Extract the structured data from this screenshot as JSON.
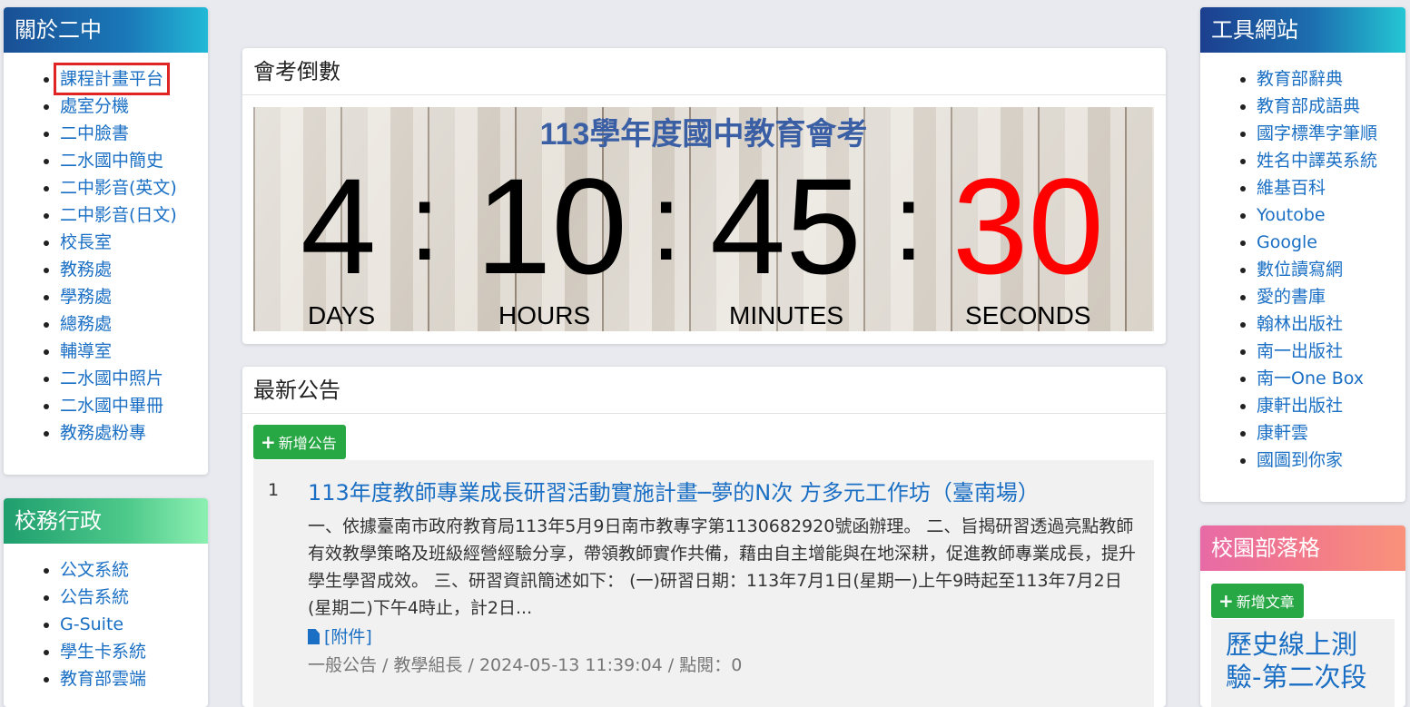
{
  "about": {
    "header": "關於二中",
    "items": [
      "課程計畫平台",
      "處室分機",
      "二中臉書",
      "二水國中簡史",
      "二中影音(英文)",
      "二中影音(日文)",
      "校長室",
      "教務處",
      "學務處",
      "總務處",
      "輔導室",
      "二水國中照片",
      "二水國中畢冊",
      "教務處粉專"
    ]
  },
  "admin": {
    "header": "校務行政",
    "items": [
      "公文系統",
      "公告系統",
      "G-Suite",
      "學生卡系統",
      "教育部雲端"
    ]
  },
  "countdown": {
    "header": "會考倒數",
    "title": "113學年度國中教育會考",
    "days": "4",
    "hours": "10",
    "minutes": "45",
    "seconds": "30",
    "colon": ":",
    "labels": {
      "days": "DAYS",
      "hours": "HOURS",
      "minutes": "MINUTES",
      "seconds": "SECONDS"
    },
    "colors": {
      "digits": "#000000",
      "seconds": "#ff0000",
      "title": "#3a5fa5"
    }
  },
  "news": {
    "header": "最新公告",
    "add_button": "新增公告",
    "plus_icon": "plus-icon",
    "items": [
      {
        "num": "1",
        "title": "113年度教師專業成長研習活動實施計畫─夢的N次 方多元工作坊（臺南場）",
        "body": "一、依據臺南市政府教育局113年5月9日南市教專字第1130682920號函辦理。 二、旨揭研習透過亮點教師有效教學策略及班級經營經驗分享，帶領教師實作共備，藉由自主增能與在地深耕，促進教師專業成長，提升學生學習成效。 三、研習資訊簡述如下： (一)研習日期：113年7月1日(星期一)上午9時起至113年7月2日(星期二)下午4時止，計2日...",
        "attach": "[附件]",
        "meta": "一般公告 / 教學組長 / 2024-05-13 11:39:04 / 點閱：0"
      }
    ]
  },
  "tools": {
    "header": "工具網站",
    "items": [
      "教育部辭典",
      "教育部成語典",
      "國字標準字筆順",
      "姓名中譯英系統",
      "維基百科",
      "Youtobe",
      "Google",
      "數位讀寫網",
      "愛的書庫",
      "翰林出版社",
      "南一出版社",
      "南一One Box",
      "康軒出版社",
      "康軒雲",
      "國圖到你家"
    ]
  },
  "blog": {
    "header": "校園部落格",
    "add_button": "新增文章",
    "post_title": "歷史線上測驗-第二次段"
  }
}
